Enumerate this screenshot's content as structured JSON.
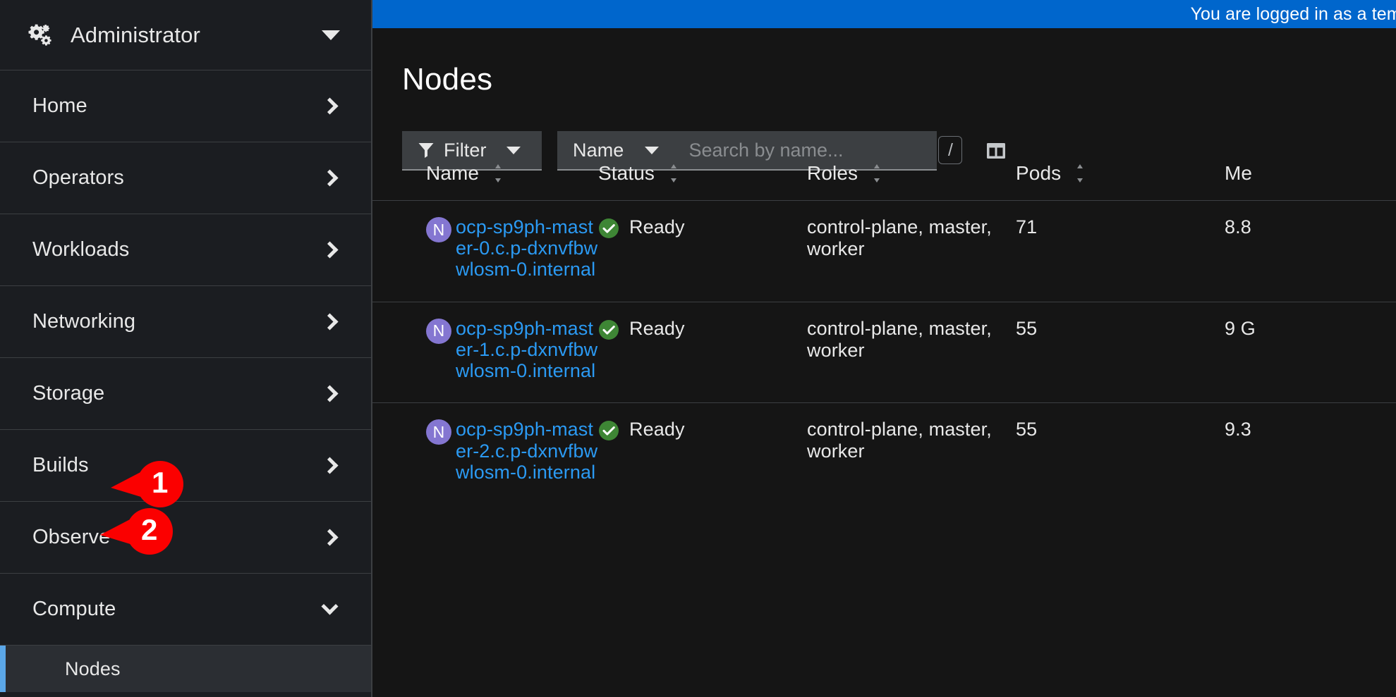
{
  "banner": {
    "message": "You are logged in as a temporary administrator"
  },
  "sidebar": {
    "perspective": {
      "label": "Administrator",
      "icon": "cogs-icon",
      "caret": "caret-down-icon"
    },
    "items": [
      {
        "label": "Home",
        "icon": "chevron-right-icon",
        "expanded": false
      },
      {
        "label": "Operators",
        "icon": "chevron-right-icon",
        "expanded": false
      },
      {
        "label": "Workloads",
        "icon": "chevron-right-icon",
        "expanded": false
      },
      {
        "label": "Networking",
        "icon": "chevron-right-icon",
        "expanded": false
      },
      {
        "label": "Storage",
        "icon": "chevron-right-icon",
        "expanded": false
      },
      {
        "label": "Builds",
        "icon": "chevron-right-icon",
        "expanded": false
      },
      {
        "label": "Observe",
        "icon": "chevron-right-icon",
        "expanded": false
      },
      {
        "label": "Compute",
        "icon": "chevron-down-icon",
        "expanded": true
      }
    ],
    "subitems": [
      {
        "label": "Nodes",
        "selected": true
      }
    ]
  },
  "page": {
    "title": "Nodes"
  },
  "toolbar": {
    "filter_label": "Filter",
    "filter_icon": "funnel-icon",
    "attribute_label": "Name",
    "search_placeholder": "Search by name...",
    "search_value": "",
    "search_shortcut": "/",
    "column_management_icon": "column-management-icon"
  },
  "table": {
    "columns": [
      {
        "label": "Name",
        "sortable": true
      },
      {
        "label": "Status",
        "sortable": true
      },
      {
        "label": "Roles",
        "sortable": true
      },
      {
        "label": "Pods",
        "sortable": true
      },
      {
        "label": "Me",
        "sortable": false
      }
    ],
    "rows": [
      {
        "badge": "N",
        "name": "ocp-sp9ph-master-0.c.p-dxnvfbwwlosm-0.internal",
        "status": "Ready",
        "roles": "control-plane, master, worker",
        "pods": "71",
        "memory": "8.8"
      },
      {
        "badge": "N",
        "name": "ocp-sp9ph-master-1.c.p-dxnvfbwwlosm-0.internal",
        "status": "Ready",
        "roles": "control-plane, master, worker",
        "pods": "55",
        "memory": "9 G"
      },
      {
        "badge": "N",
        "name": "ocp-sp9ph-master-2.c.p-dxnvfbwwlosm-0.internal",
        "status": "Ready",
        "roles": "control-plane, master, worker",
        "pods": "55",
        "memory": "9.3"
      }
    ]
  },
  "callouts": [
    {
      "number": "1",
      "target": "Compute"
    },
    {
      "number": "2",
      "target": "Nodes"
    }
  ],
  "colors": {
    "banner": "#0066cc",
    "sidebar_bg": "#1b1d21",
    "main_bg": "#151515",
    "selected_bg": "#2b2e33",
    "selected_border": "#5ba7e8",
    "link": "#2b9af3",
    "badge_purple": "#8476d1",
    "status_green": "#3e8635",
    "callout_red": "#fb0000"
  }
}
